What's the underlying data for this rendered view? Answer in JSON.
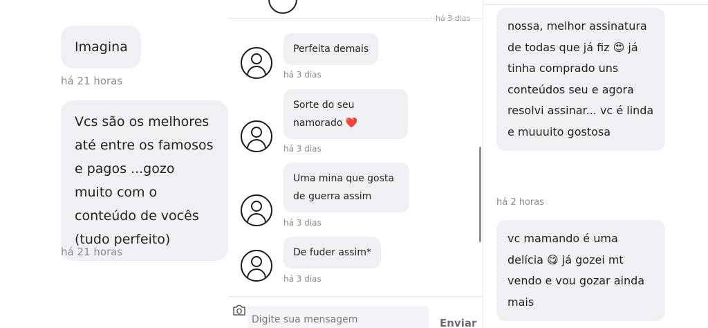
{
  "left": {
    "messages": [
      {
        "text": "Imagina",
        "time": "há 21 horas"
      },
      {
        "text": "Vcs são os melhores até entre os famosos e pagos ...gozo muito com o conteúdo de vocês (tudo perfeito)",
        "time": "há 21 horas"
      }
    ]
  },
  "mid": {
    "top_cut_time": "há 3 dias",
    "messages": [
      {
        "text": "Perfeita demais",
        "time": "há 3 dias"
      },
      {
        "text": "Sorte do seu namorado ❤️",
        "time": "há 3 dias"
      },
      {
        "text": "Uma mina que gosta de guerra assim",
        "time": "há 3 dias"
      },
      {
        "text": "De fuder assim*",
        "time": "há 3 dias"
      }
    ],
    "composer": {
      "placeholder": "Digite sua mensagem",
      "send_label": "Enviar"
    }
  },
  "right": {
    "messages": [
      {
        "text": "nossa, melhor assinatura de todas que já fiz 😍 já tinha comprado uns conteúdos seu e agora resolvi assinar... vc é linda e muuuito gostosa",
        "time": "há 2 horas"
      },
      {
        "text": "vc mamando é uma delícia 😋 já gozei mt vendo e vou gozar ainda mais",
        "time": ""
      }
    ]
  },
  "icons": [
    "avatar-icon",
    "camera-icon"
  ],
  "colors": {
    "bubble": "#eef0f4",
    "time": "#8a8a8f",
    "heart": "#e53935"
  }
}
